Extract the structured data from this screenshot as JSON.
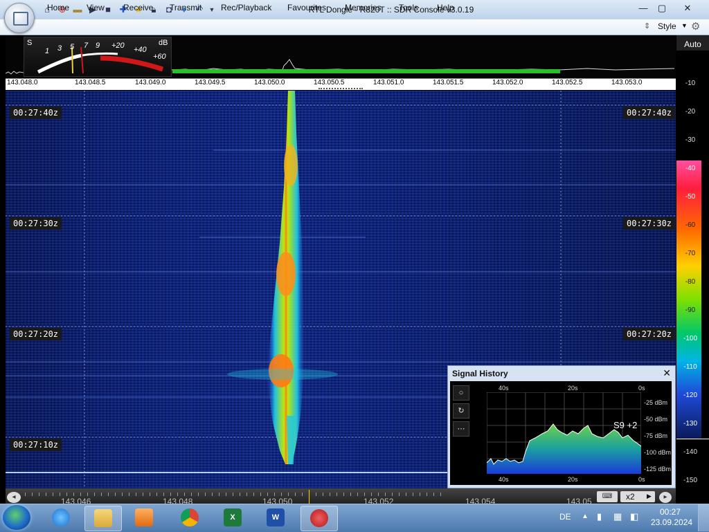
{
  "window": {
    "title": "RTL Dongle - R820T :: SDR Console v3.0.19"
  },
  "quick_access": [
    "home-icon",
    "lifebuoy-icon",
    "folder-icon",
    "play-icon",
    "stop-icon",
    "plus-icon",
    "star-icon",
    "lock-icon",
    "camera-icon",
    "drop-icon",
    "undo-icon",
    "dropdown-icon"
  ],
  "menu": {
    "items": [
      "Home",
      "View",
      "Receive",
      "Transmit",
      "Rec/Playback",
      "Favourites",
      "Memories",
      "Tools",
      "Help"
    ],
    "style_label": "Style"
  },
  "smeter": {
    "s_label": "S",
    "db_label": "dB",
    "s_scale": [
      "1",
      "3",
      "5",
      "7",
      "9"
    ],
    "plus_scale": [
      "+20",
      "+40",
      "+60"
    ],
    "level_s": 7
  },
  "auto_label": "Auto",
  "top_frequency_ticks": [
    "143.048.0",
    "143.048.5",
    "143.049.0",
    "143.049.5",
    "143.050.0",
    "143.050.5",
    "143.051.0",
    "143.051.5",
    "143.052.0",
    "143.052.5",
    "143.053.0"
  ],
  "waterfall": {
    "timestamps": [
      "00:27:40z",
      "00:27:30z",
      "00:27:20z",
      "00:27:10z"
    ]
  },
  "db_scale": [
    "-10",
    "-20",
    "-30",
    "-40",
    "-50",
    "-60",
    "-70",
    "-80",
    "-90",
    "-100",
    "-110",
    "-120",
    "-130",
    "-140",
    "-150"
  ],
  "bottom_frequency_ticks": [
    "143.046",
    "143.048",
    "143.050",
    "143.052",
    "143.054",
    "143.05"
  ],
  "bottom_controls": {
    "zoom_label": "x2"
  },
  "signal_history": {
    "title": "Signal History",
    "time_labels_top": [
      "40s",
      "20s",
      "0s"
    ],
    "time_labels_bottom": [
      "40s",
      "20s",
      "0s"
    ],
    "dbm_labels": [
      "-25 dBm",
      "-50 dBm",
      "-75 dBm",
      "-100 dBm",
      "-125 dBm"
    ],
    "reading": "S9 +2",
    "buttons": [
      "record-icon",
      "reset-icon",
      "more-icon"
    ]
  },
  "taskbar": {
    "apps": [
      "internet-explorer-icon",
      "file-explorer-icon",
      "media-player-icon",
      "chrome-icon",
      "excel-icon",
      "word-icon",
      "sdr-console-icon"
    ],
    "language": "DE",
    "time": "00:27",
    "date": "23.09.2024"
  },
  "colors": {
    "waterfall_bg": "#0f2580",
    "signal_core": "#ff8c1a",
    "signal_mid": "#e6f000",
    "signal_edge": "#1ec8e6",
    "spectrum_green": "#2bbf2b",
    "meter_red": "#d01818"
  }
}
